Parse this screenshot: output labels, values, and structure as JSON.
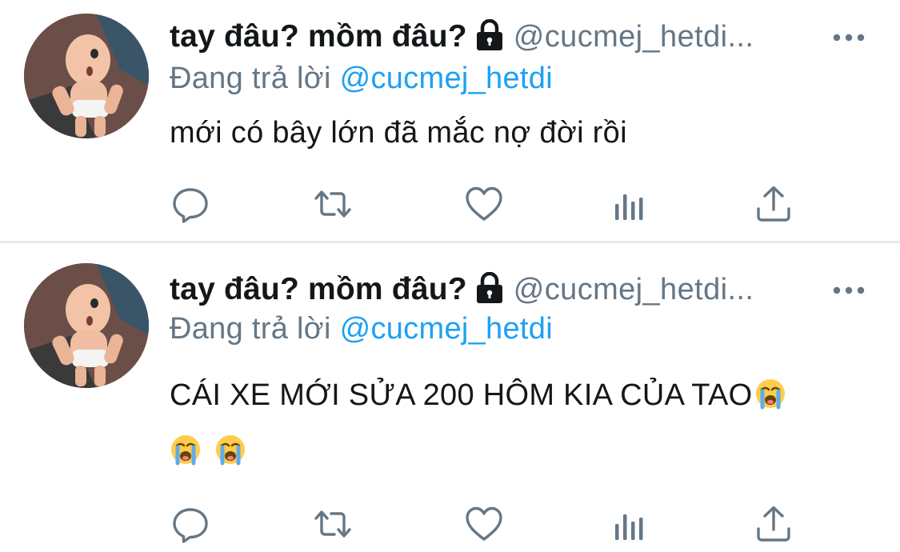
{
  "tweets": [
    {
      "display_name": "tay đâu? mồm đâu?",
      "handle": "@cucmej_hetdi...",
      "replying_prefix": "Đang trả lời",
      "replying_to": "@cucmej_hetdi",
      "text_lines": [
        "mới có bây lớn đã mắc nợ đời rồi"
      ],
      "emojis_line": []
    },
    {
      "display_name": "tay đâu? mồm đâu?",
      "handle": "@cucmej_hetdi...",
      "replying_prefix": "Đang trả lời",
      "replying_to": "@cucmej_hetdi",
      "text_lines": [
        "CÁI XE MỚI SỬA 200 HÔM KIA CỦA TAO"
      ],
      "emojis_line": [
        "loudly-crying-face",
        "loudly-crying-face"
      ]
    }
  ],
  "icons": {
    "lock": "lock-icon",
    "more": "more-options-icon",
    "reply": "reply-icon",
    "retweet": "retweet-icon",
    "like": "heart-icon",
    "stats": "analytics-icon",
    "share": "share-icon",
    "inline_emoji": "loudly-crying-face"
  },
  "colors": {
    "text": "#14171a",
    "secondary": "#657786",
    "link": "#1da1f2",
    "icon": "#657786",
    "divider": "#e7e9ec"
  }
}
